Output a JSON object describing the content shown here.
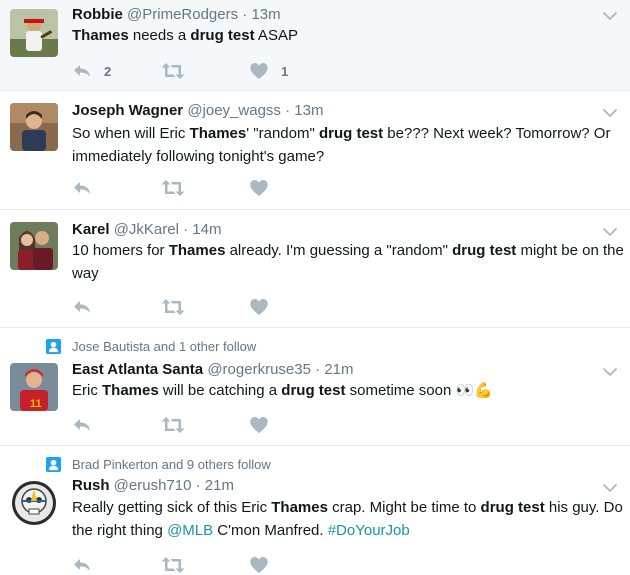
{
  "colors": {
    "text": "#14171a",
    "secondary": "#657786",
    "link": "#1b95a6",
    "divider": "#e6ecf0",
    "highlight_bg": "#f5f8fa",
    "icon_gray": "#aab8c2",
    "context_icon": "#1da1f2"
  },
  "icons": {
    "reply": "reply-icon",
    "retweet": "retweet-icon",
    "like": "heart-icon",
    "more": "chevron-down-icon",
    "follow_context": "person-icon"
  },
  "tweets": [
    {
      "name": "Robbie",
      "handle": "@PrimeRodgers",
      "dot": "·",
      "time": "13m",
      "text": [
        "Thames",
        " needs a ",
        "drug test",
        " ASAP"
      ],
      "reply_count": "2",
      "like_count": "1"
    },
    {
      "name": "Joseph Wagner",
      "handle": "@joey_wagss",
      "dot": "·",
      "time": "13m",
      "text": [
        "So when will Eric ",
        "Thames",
        "' \"random\" ",
        "drug test",
        " be??? Next week? Tomorrow? Or immediately following tonight's game?"
      ]
    },
    {
      "name": "Karel",
      "handle": "@JkKarel",
      "dot": "·",
      "time": "14m",
      "text": [
        "10 homers for ",
        "Thames",
        " already. I'm guessing a \"random\" ",
        "drug test",
        " might be on the way"
      ]
    },
    {
      "context": "Jose Bautista and 1 other follow",
      "name": "East Atlanta Santa",
      "handle": "@rogerkruse35",
      "dot": "·",
      "time": "21m",
      "text": [
        "Eric ",
        "Thames",
        " will be catching a ",
        "drug test",
        " sometime soon ",
        "👀💪"
      ]
    },
    {
      "context": "Brad Pinkerton and 9 others follow",
      "name": "Rush",
      "handle": "@erush710",
      "dot": "·",
      "time": "21m",
      "text": [
        "Really getting sick of this Eric ",
        "Thames",
        " crap. Might be time to ",
        "drug test",
        " his guy. Do the right thing ",
        "@MLB",
        " C'mon Manfred. ",
        "#DoYourJob"
      ]
    }
  ]
}
